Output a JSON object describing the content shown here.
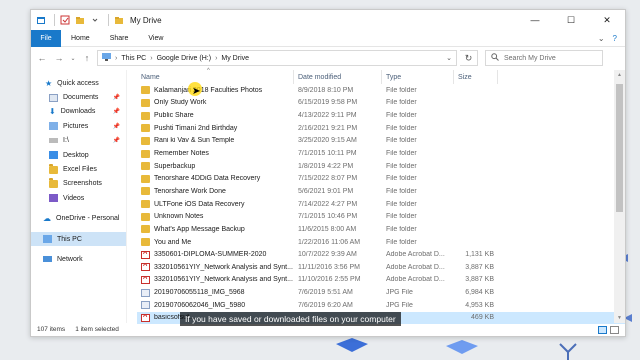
{
  "window": {
    "title": "My Drive",
    "controls": {
      "minimize": "—",
      "maximize": "☐",
      "close": "✕"
    }
  },
  "ribbon": {
    "tabs": [
      "File",
      "Home",
      "Share",
      "View"
    ]
  },
  "address": {
    "segments": [
      "This PC",
      "Google Drive (H:)",
      "My Drive"
    ],
    "search_placeholder": "Search My Drive"
  },
  "nav": {
    "items": [
      {
        "label": "Quick access",
        "icon": "star-icon",
        "pinned": false
      },
      {
        "label": "Documents",
        "icon": "documents-icon",
        "pinned": true
      },
      {
        "label": "Downloads",
        "icon": "downloads-icon",
        "pinned": true
      },
      {
        "label": "Pictures",
        "icon": "pictures-icon",
        "pinned": true
      },
      {
        "label": "I:\\",
        "icon": "drive-icon",
        "pinned": true
      },
      {
        "label": "Desktop",
        "icon": "desktop-icon",
        "pinned": false
      },
      {
        "label": "Excel Files",
        "icon": "folder-icon",
        "pinned": false
      },
      {
        "label": "Screenshots",
        "icon": "folder-icon",
        "pinned": false
      },
      {
        "label": "Videos",
        "icon": "videos-icon",
        "pinned": false
      },
      {
        "label": "OneDrive - Personal",
        "icon": "cloud-icon",
        "pinned": false
      },
      {
        "label": "This PC",
        "icon": "pc-icon",
        "pinned": false
      },
      {
        "label": "Network",
        "icon": "network-icon",
        "pinned": false
      }
    ]
  },
  "columns": {
    "name": "Name",
    "date": "Date modified",
    "type": "Type",
    "size": "Size"
  },
  "files": [
    {
      "name": "Kalamanjari 2018 Faculties Photos",
      "date": "8/9/2018 8:10 PM",
      "type": "File folder",
      "size": "",
      "kind": "folder"
    },
    {
      "name": "Only Study Work",
      "date": "6/15/2019 9:58 PM",
      "type": "File folder",
      "size": "",
      "kind": "folder"
    },
    {
      "name": "Public Share",
      "date": "4/13/2022 9:11 PM",
      "type": "File folder",
      "size": "",
      "kind": "folder"
    },
    {
      "name": "Pushti Timani 2nd Birthday",
      "date": "2/16/2021 9:21 PM",
      "type": "File folder",
      "size": "",
      "kind": "folder"
    },
    {
      "name": "Rani ki Vav & Sun Temple",
      "date": "3/25/2020 9:15 AM",
      "type": "File folder",
      "size": "",
      "kind": "folder"
    },
    {
      "name": "Remember Notes",
      "date": "7/1/2015 10:11 PM",
      "type": "File folder",
      "size": "",
      "kind": "folder"
    },
    {
      "name": "Superbackup",
      "date": "1/8/2019 4:22 PM",
      "type": "File folder",
      "size": "",
      "kind": "folder"
    },
    {
      "name": "Tenorshare 4DDiG Data Recovery",
      "date": "7/15/2022 8:07 PM",
      "type": "File folder",
      "size": "",
      "kind": "folder"
    },
    {
      "name": "Tenorshare Work Done",
      "date": "5/6/2021 9:01 PM",
      "type": "File folder",
      "size": "",
      "kind": "folder"
    },
    {
      "name": "ULTFone iOS Data Recovery",
      "date": "7/14/2022 4:27 PM",
      "type": "File folder",
      "size": "",
      "kind": "folder"
    },
    {
      "name": "Unknown Notes",
      "date": "7/1/2015 10:46 PM",
      "type": "File folder",
      "size": "",
      "kind": "folder"
    },
    {
      "name": "What's App Message Backup",
      "date": "11/6/2015 8:00 AM",
      "type": "File folder",
      "size": "",
      "kind": "folder"
    },
    {
      "name": "You and Me",
      "date": "1/22/2016 11:06 AM",
      "type": "File folder",
      "size": "",
      "kind": "folder"
    },
    {
      "name": "3350601-DIPLOMA-SUMMER-2020",
      "date": "10/7/2022 9:39 AM",
      "type": "Adobe Acrobat D...",
      "size": "1,131 KB",
      "kind": "pdf"
    },
    {
      "name": "332010561YIY_Network Analysis and Synt...",
      "date": "11/11/2016 3:56 PM",
      "type": "Adobe Acrobat D...",
      "size": "3,887 KB",
      "kind": "pdf"
    },
    {
      "name": "332010561YIY_Network Analysis and Synt...",
      "date": "11/10/2016 2:55 PM",
      "type": "Adobe Acrobat D...",
      "size": "3,887 KB",
      "kind": "pdf"
    },
    {
      "name": "20190706055118_IMG_5968",
      "date": "7/6/2019 5:51 AM",
      "type": "JPG File",
      "size": "6,984 KB",
      "kind": "img"
    },
    {
      "name": "20190706062046_IMG_5980",
      "date": "7/6/2019 6:20 AM",
      "type": "JPG File",
      "size": "4,953 KB",
      "kind": "img"
    },
    {
      "name": "basicsofsuf...",
      "date": "",
      "type": "",
      "size": "469 KB",
      "kind": "pdf",
      "selected": true
    }
  ],
  "status": {
    "count": "107 items",
    "selection": "1 item selected"
  },
  "caption": "If you have saved or downloaded files on your computer"
}
